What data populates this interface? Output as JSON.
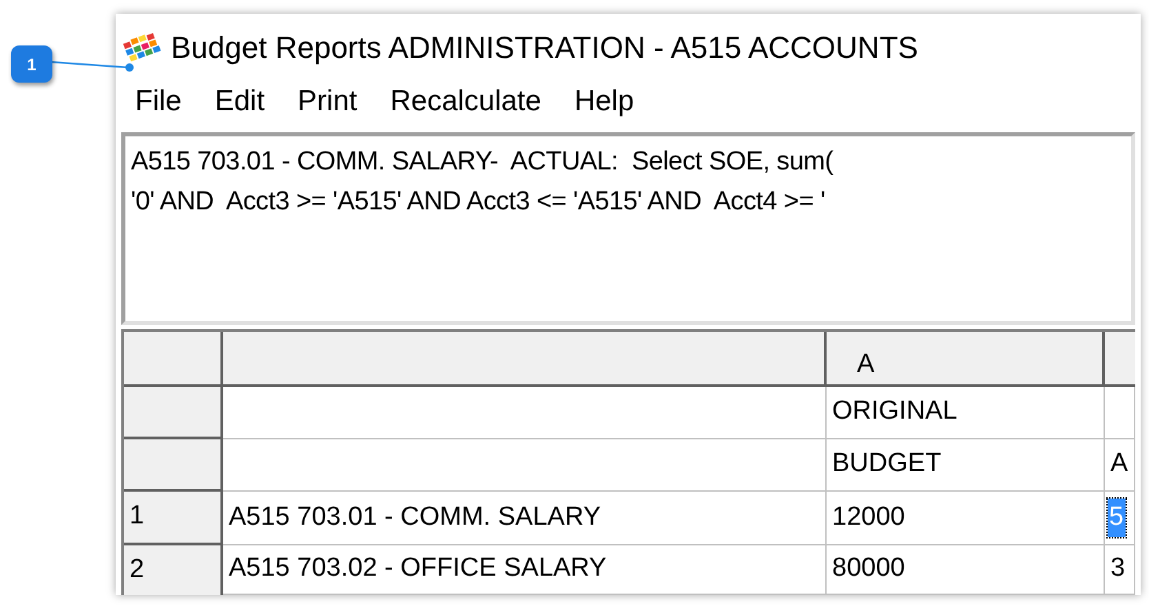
{
  "callout": {
    "number": "1"
  },
  "window": {
    "title": "Budget Reports ADMINISTRATION - A515 ACCOUNTS"
  },
  "menu": [
    "File",
    "Edit",
    "Print",
    "Recalculate",
    "Help"
  ],
  "query_text": [
    "A515 703.01 - COMM. SALARY-  ACTUAL:  Select SOE, sum(",
    "'0' AND  Acct3 >= 'A515' AND Acct3 <= 'A515' AND  Acct4 >= '"
  ],
  "grid": {
    "columns": [
      "",
      "A",
      ""
    ],
    "header_rows": [
      {
        "cells": [
          "",
          "ORIGINAL",
          ""
        ]
      },
      {
        "cells": [
          "",
          "BUDGET",
          "A"
        ]
      }
    ],
    "rows": [
      {
        "number": "1",
        "cells": [
          {
            "text": "A515 703.01 - COMM. SALARY",
            "selected": false
          },
          {
            "text": "12000",
            "selected": false
          },
          {
            "text": "5",
            "selected": true
          }
        ]
      },
      {
        "number": "2",
        "cells": [
          {
            "text": "A515 703.02 - OFFICE SALARY",
            "selected": false
          },
          {
            "text": "80000",
            "selected": false
          },
          {
            "text": "3",
            "selected": false
          }
        ]
      }
    ]
  }
}
